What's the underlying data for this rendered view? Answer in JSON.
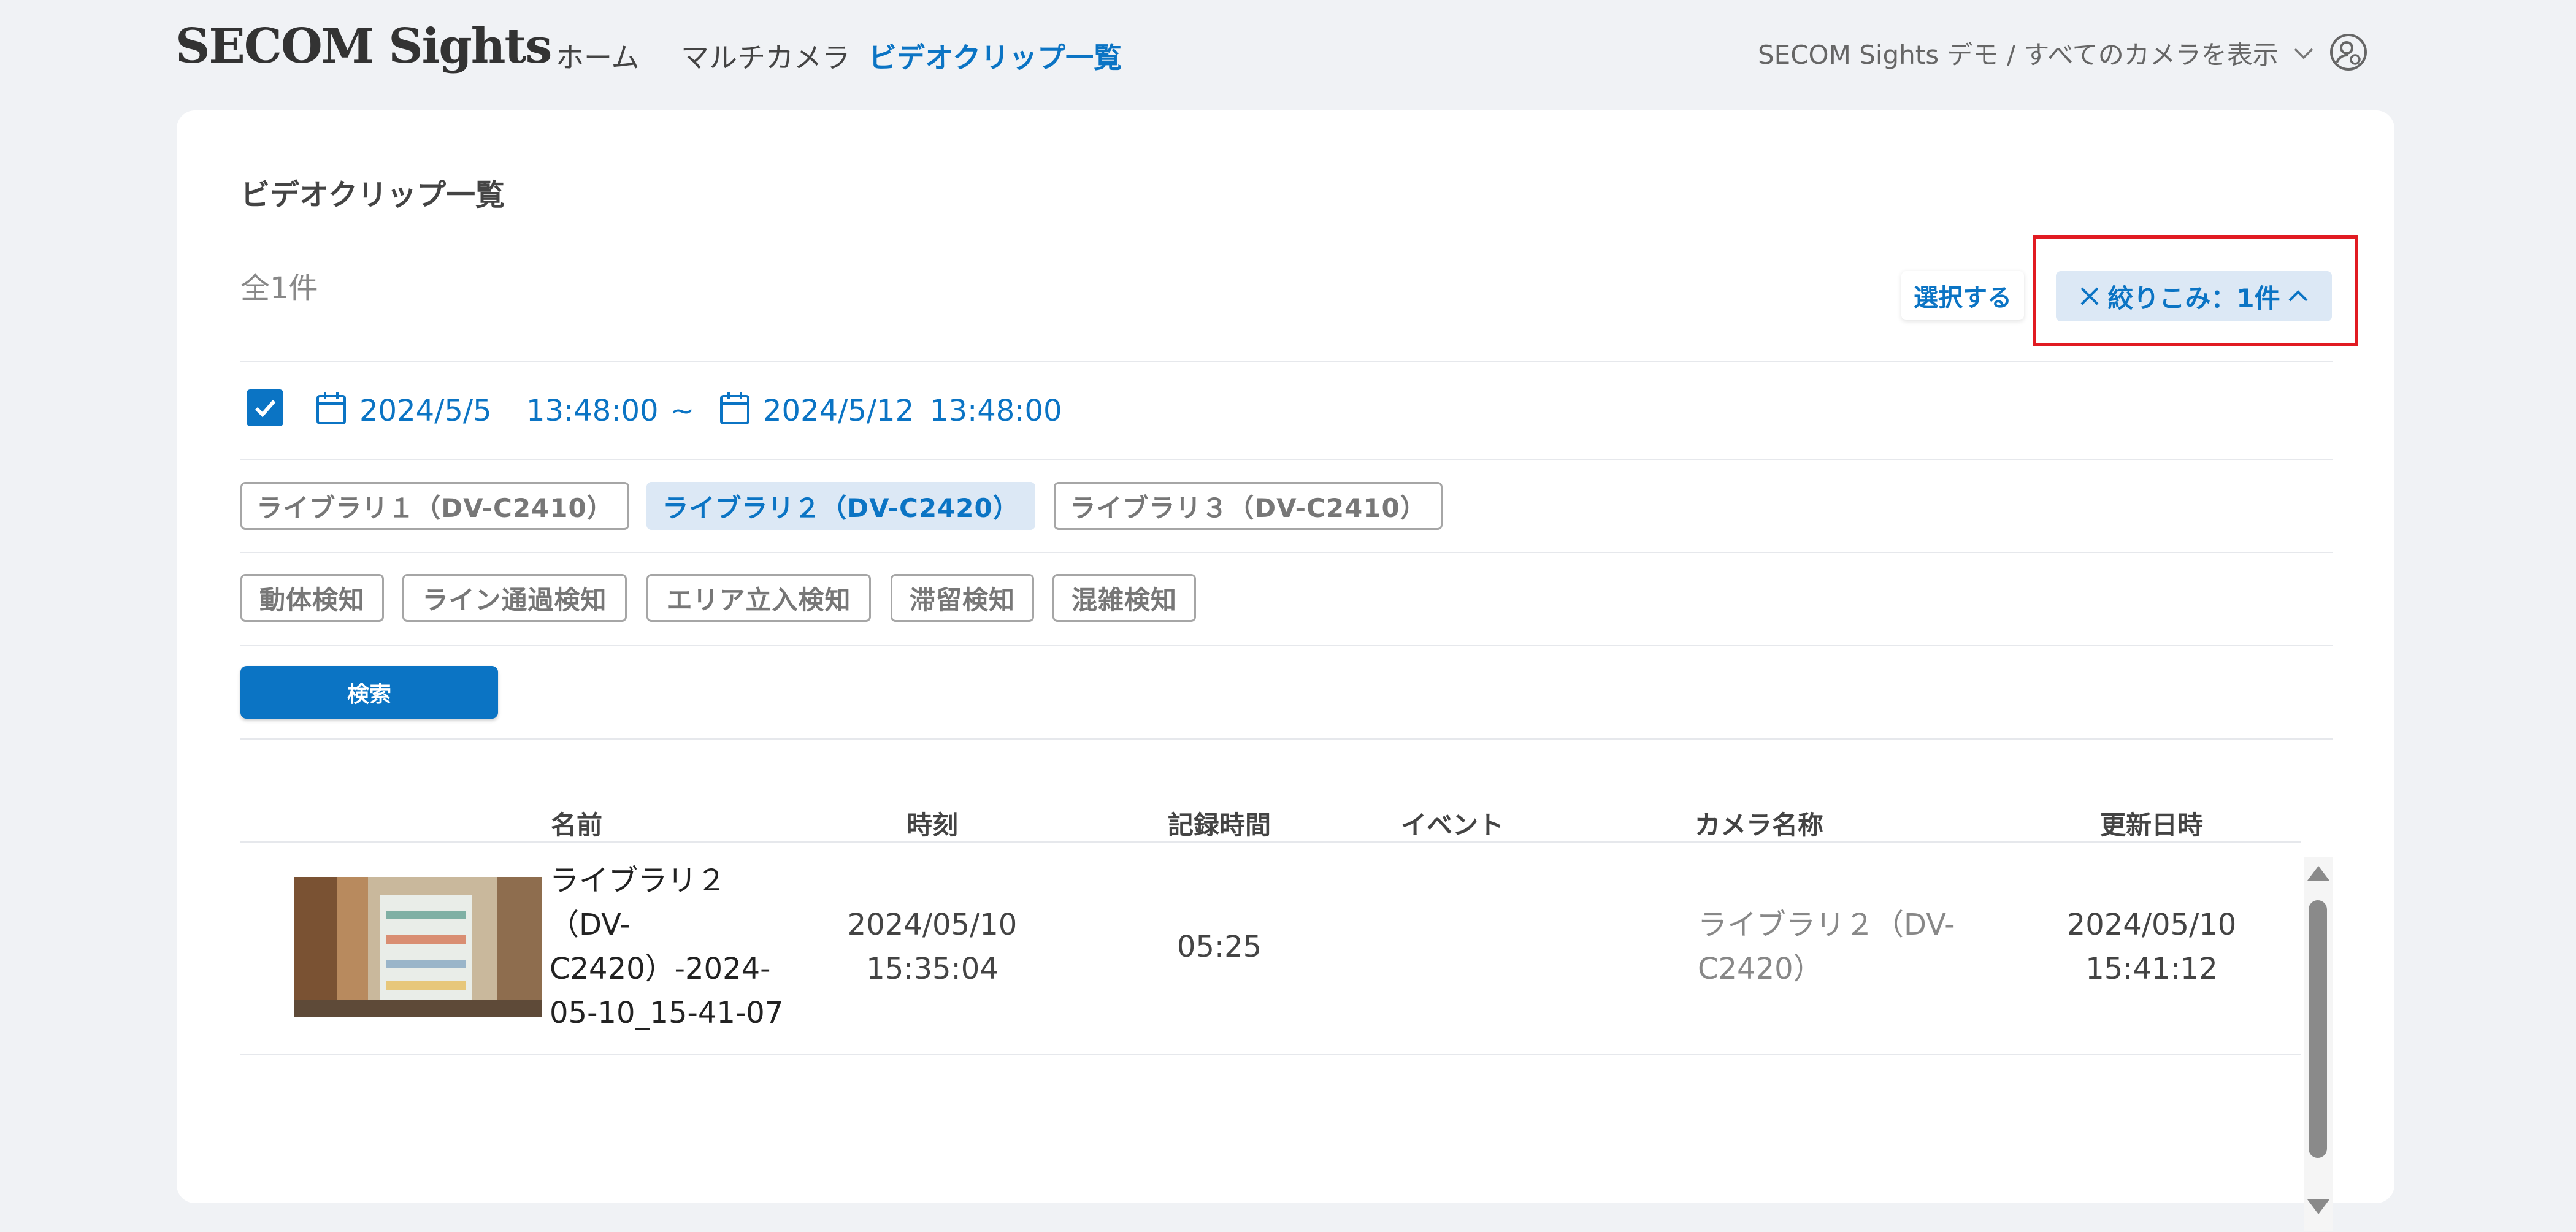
{
  "header": {
    "logo": "SECOM Sights",
    "nav": [
      "ホーム",
      "マルチカメラ",
      "ビデオクリップ一覧"
    ],
    "tenant": "SECOM Sights デモ / すべてのカメラを表示"
  },
  "page": {
    "title": "ビデオクリップ一覧",
    "count": "全1件",
    "select_label": "選択する",
    "filter_label": "絞りこみ：1件"
  },
  "date_range": {
    "enabled": true,
    "start_date": "2024/5/5",
    "start_time": "13:48:00",
    "separator": "~",
    "end_date": "2024/5/12",
    "end_time": "13:48:00"
  },
  "libraries": [
    {
      "label": "ライブラリ１（DV-C2410）",
      "selected": false
    },
    {
      "label": "ライブラリ２（DV-C2420）",
      "selected": true
    },
    {
      "label": "ライブラリ３（DV-C2410）",
      "selected": false
    }
  ],
  "events": [
    "動体検知",
    "ライン通過検知",
    "エリア立入検知",
    "滞留検知",
    "混雑検知"
  ],
  "search_label": "検索",
  "table": {
    "headers": [
      "名前",
      "時刻",
      "記録時間",
      "イベント",
      "カメラ名称",
      "更新日時"
    ],
    "rows": [
      {
        "name_lines": [
          "ライブラリ２",
          "（DV-",
          "C2420）-2024-",
          "05-10_15-41-07"
        ],
        "time_lines": [
          "2024/05/10",
          "15:35:04"
        ],
        "duration": "05:25",
        "event": "",
        "camera_lines": [
          "ライブラリ２（DV-",
          "C2420）"
        ],
        "updated_lines": [
          "2024/05/10",
          "15:41:12"
        ]
      }
    ]
  },
  "colors": {
    "accent": "#0b74c4",
    "chip_selected_bg": "#dce8f5",
    "highlight": "#e11b22",
    "background": "#f0f2f5"
  }
}
